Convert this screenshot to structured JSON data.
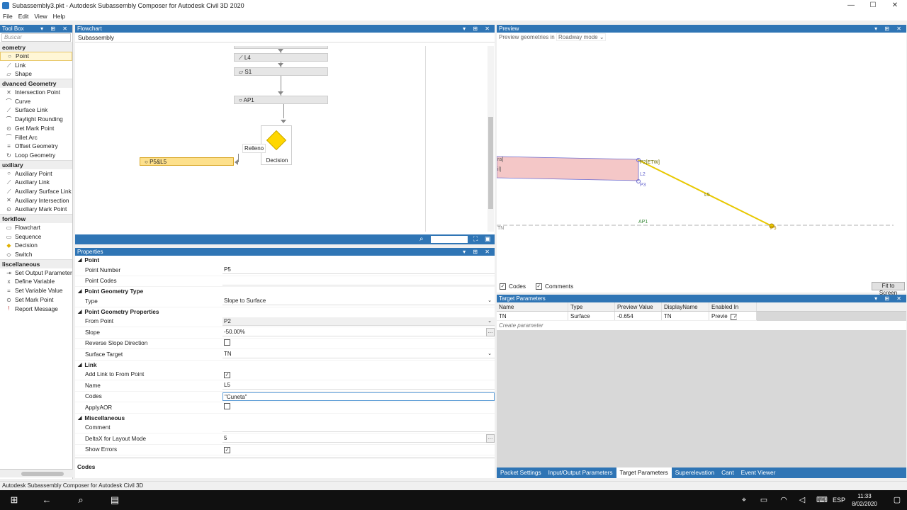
{
  "titlebar": {
    "title": "Subassembly3.pkt - Autodesk Subassembly Composer for Autodesk Civil 3D 2020",
    "min": "—",
    "max": "☐",
    "close": "✕"
  },
  "menu": [
    "File",
    "Edit",
    "View",
    "Help"
  ],
  "toolbox": {
    "title": "Tool Box",
    "search_placeholder": "Buscar",
    "categories": [
      {
        "name": "eometry",
        "items": [
          "Point",
          "Link",
          "Shape"
        ]
      },
      {
        "name": "dvanced Geometry",
        "items": [
          "Intersection Point",
          "Curve",
          "Surface Link",
          "Daylight Rounding",
          "Get Mark Point",
          "Fillet Arc",
          "Offset Geometry",
          "Loop Geometry"
        ]
      },
      {
        "name": "uxiliary",
        "items": [
          "Auxiliary Point",
          "Auxiliary Link",
          "Auxiliary Surface Link",
          "Auxiliary Intersection",
          "Auxiliary Mark Point"
        ]
      },
      {
        "name": "forkflow",
        "items": [
          "Flowchart",
          "Sequence",
          "Decision",
          "Switch"
        ]
      },
      {
        "name": "liscellaneous",
        "items": [
          "Set Output Parameter",
          "Define Variable",
          "Set Variable Value",
          "Set Mark Point",
          "Report Message"
        ]
      }
    ]
  },
  "flowchart": {
    "title": "Flowchart",
    "tab": "Subassembly",
    "nodes": {
      "l4": "L4",
      "s1": "S1",
      "ap1": "AP1",
      "p5l5": "P5&L5",
      "decision": "Decision",
      "relleno": "Relleno"
    }
  },
  "properties": {
    "title": "Properties",
    "sections": {
      "point": "Point",
      "geomtype": "Point Geometry Type",
      "geomprops": "Point Geometry Properties",
      "link": "Link",
      "misc": "Miscellaneous"
    },
    "labels": {
      "point_number": "Point Number",
      "point_codes": "Point Codes",
      "type": "Type",
      "from_point": "From Point",
      "slope": "Slope",
      "reverse": "Reverse Slope Direction",
      "surface_target": "Surface Target",
      "add_link": "Add Link to From Point",
      "name": "Name",
      "codes": "Codes",
      "applyaor": "ApplyAOR",
      "comment": "Comment",
      "deltax": "DeltaX for Layout Mode",
      "show_errors": "Show Errors"
    },
    "values": {
      "point_number": "P5",
      "point_codes": "",
      "type": "Slope to Surface",
      "from_point": "P2",
      "slope": "-50.00%",
      "surface_target": "TN",
      "name": "L5",
      "codes": "\"Cuneta\"",
      "comment": "",
      "deltax": "5"
    },
    "checks": {
      "reverse": false,
      "add_link": true,
      "applyaor": false,
      "show_errors": true
    },
    "footer": "Codes"
  },
  "preview": {
    "title": "Preview",
    "mode_label": "Preview geometries in",
    "mode_value": "Roadway mode",
    "codes_label": "Codes",
    "comments_label": "Comments",
    "fit_button": "Fit to Screen",
    "labels": {
      "p2": "P2[ETW]",
      "l2": "L2",
      "p3": "P3",
      "l5": "L5",
      "p5": "P5",
      "ap1": "AP1",
      "tn": "TN",
      "ra": "ra]",
      "il": "il]"
    }
  },
  "target_params": {
    "title": "Target Parameters",
    "columns": [
      "Name",
      "Type",
      "Preview Value",
      "DisplayName",
      "Enabled In Previe"
    ],
    "rows": [
      {
        "name": "TN",
        "type": "Surface",
        "preview": "-0.654",
        "display": "TN",
        "enabled": true
      }
    ],
    "create": "Create parameter"
  },
  "tabs": [
    "Packet Settings",
    "Input/Output Parameters",
    "Target Parameters",
    "Superelevation",
    "Cant",
    "Event Viewer"
  ],
  "status": "Autodesk Subassembly Composer for Autodesk Civil 3D",
  "taskbar": {
    "lang": "ESP",
    "time": "11:33",
    "date": "8/02/2020"
  },
  "colors": {
    "accent": "#2f75b5",
    "selected": "#fde08c",
    "decision": "#ffd700",
    "shape_fill": "#f4c7c7",
    "link": "#e8c800"
  }
}
